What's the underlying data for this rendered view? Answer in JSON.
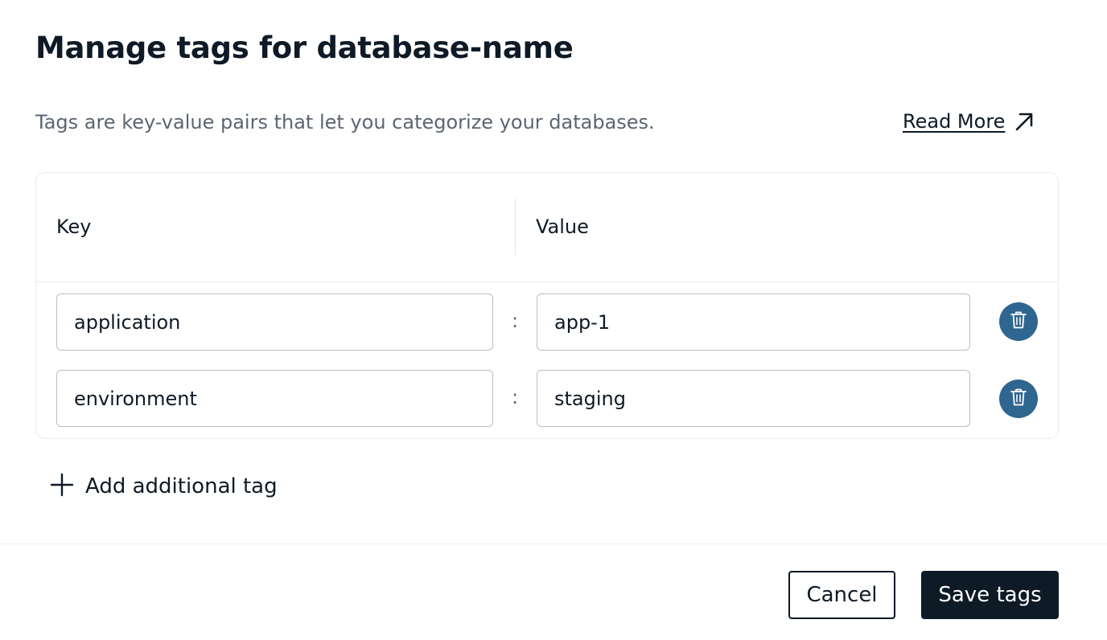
{
  "dialog": {
    "title": "Manage tags for database-name",
    "description": "Tags are key-value pairs that let you categorize your databases.",
    "read_more_label": "Read More",
    "read_more_icon": "arrow-up-right-icon"
  },
  "table": {
    "key_header": "Key",
    "value_header": "Value",
    "separator": ":",
    "rows": [
      {
        "key": "application",
        "value": "app-1",
        "delete_icon": "trash-icon"
      },
      {
        "key": "environment",
        "value": "staging",
        "delete_icon": "trash-icon"
      }
    ]
  },
  "add_tag": {
    "label": "Add additional tag",
    "icon": "plus-icon"
  },
  "footer": {
    "cancel_label": "Cancel",
    "save_label": "Save tags"
  },
  "colors": {
    "primary_dark": "#0e1a26",
    "delete_button": "#2f6690",
    "muted_text": "#5b6672"
  }
}
